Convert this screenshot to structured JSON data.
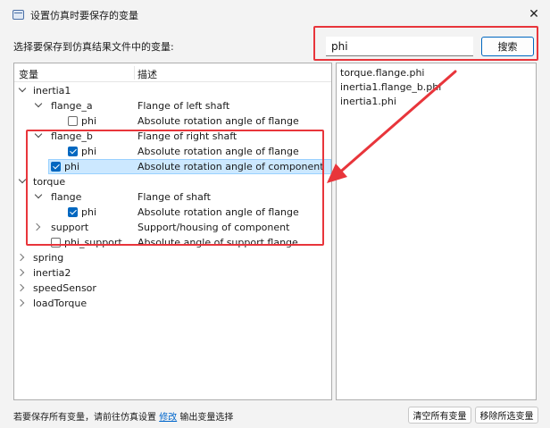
{
  "window": {
    "title": "设置仿真时要保存的变量",
    "close_symbol": "✕"
  },
  "prompt_label": "选择要保存到仿真结果文件中的变量:",
  "search": {
    "value": "phi",
    "button_label": "搜索"
  },
  "tree": {
    "headers": {
      "variable": "变量",
      "description": "描述"
    },
    "rows": [
      {
        "name": "inertia1",
        "desc": "",
        "level": 0,
        "expander": "expanded",
        "checkbox": "none"
      },
      {
        "name": "flange_a",
        "desc": "Flange of left shaft",
        "level": 1,
        "expander": "expanded",
        "checkbox": "none"
      },
      {
        "name": "phi",
        "desc": "Absolute rotation angle of flange",
        "level": 2,
        "expander": "none",
        "checkbox": "unchecked"
      },
      {
        "name": "flange_b",
        "desc": "Flange of right shaft",
        "level": 1,
        "expander": "expanded",
        "checkbox": "none"
      },
      {
        "name": "phi",
        "desc": "Absolute rotation angle of flange",
        "level": 2,
        "expander": "none",
        "checkbox": "checked"
      },
      {
        "name": "phi",
        "desc": "Absolute rotation angle of component",
        "level": 1,
        "expander": "none",
        "checkbox": "checked",
        "selected": true
      },
      {
        "name": "torque",
        "desc": "",
        "level": 0,
        "expander": "expanded",
        "checkbox": "none"
      },
      {
        "name": "flange",
        "desc": "Flange of shaft",
        "level": 1,
        "expander": "expanded",
        "checkbox": "none"
      },
      {
        "name": "phi",
        "desc": "Absolute rotation angle of flange",
        "level": 2,
        "expander": "none",
        "checkbox": "checked"
      },
      {
        "name": "support",
        "desc": "Support/housing of component",
        "level": 1,
        "expander": "collapsed",
        "checkbox": "none"
      },
      {
        "name": "phi_support",
        "desc": "Absolute angle of support flange",
        "level": 1,
        "expander": "none",
        "checkbox": "unchecked"
      },
      {
        "name": "spring",
        "desc": "",
        "level": 0,
        "expander": "collapsed",
        "checkbox": "none"
      },
      {
        "name": "inertia2",
        "desc": "",
        "level": 0,
        "expander": "collapsed",
        "checkbox": "none"
      },
      {
        "name": "speedSensor",
        "desc": "",
        "level": 0,
        "expander": "collapsed",
        "checkbox": "none"
      },
      {
        "name": "loadTorque",
        "desc": "",
        "level": 0,
        "expander": "collapsed",
        "checkbox": "none"
      }
    ]
  },
  "results": [
    "torque.flange.phi",
    "inertia1.flange_b.phi",
    "inertia1.phi"
  ],
  "footer": {
    "text_before": "若要保存所有变量，请前往仿真设置 ",
    "link": "修改",
    "text_after": " 输出变量选择",
    "clear_all_label": "清空所有变量",
    "remove_selected_label": "移除所选变量"
  },
  "colors": {
    "annotation_red": "#e8353b",
    "accent_blue": "#0067c0",
    "selection": "#cce8ff"
  }
}
